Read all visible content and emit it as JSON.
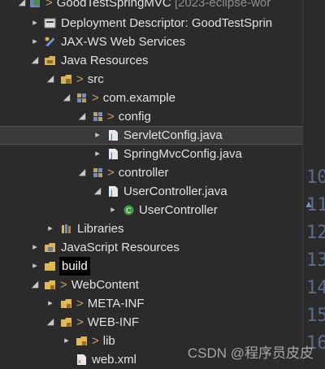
{
  "project": {
    "name": "GoodTestSpringMVC",
    "workspace": "[2023-eclipse-wor"
  },
  "tree": {
    "deployment": "Deployment Descriptor: GoodTestSprin",
    "jaxws": "JAX-WS Web Services",
    "java_resources": "Java Resources",
    "src": "src",
    "com_example": "com.example",
    "config": "config",
    "servlet_config": "ServletConfig.java",
    "springmvc_config": "SpringMvcConfig.java",
    "controller": "controller",
    "user_controller_java": "UserController.java",
    "user_controller_class": "UserController",
    "libraries": "Libraries",
    "js_resources": "JavaScript Resources",
    "build": "build",
    "webcontent": "WebContent",
    "meta_inf": "META-INF",
    "web_inf": "WEB-INF",
    "lib": "lib",
    "web_xml": "web.xml"
  },
  "gutter": {
    "lines": [
      "10",
      "11",
      "12",
      "13",
      "14",
      "15",
      "16"
    ]
  },
  "watermark": "CSDN @程序员皮皮",
  "icons": {
    "project": "web-project-icon",
    "descriptor": "deployment-descriptor-icon",
    "jaxws": "web-services-icon",
    "folder": "folder-icon",
    "package": "package-icon",
    "java_file": "java-file-icon",
    "class": "class-icon",
    "libraries": "libraries-icon",
    "js": "javascript-resources-icon"
  },
  "colors": {
    "background": "#2b2b2b",
    "selected_row": "#3a3a3a",
    "modified_marker": "#c8a06a",
    "line_numbers": "#5a6c8a"
  }
}
